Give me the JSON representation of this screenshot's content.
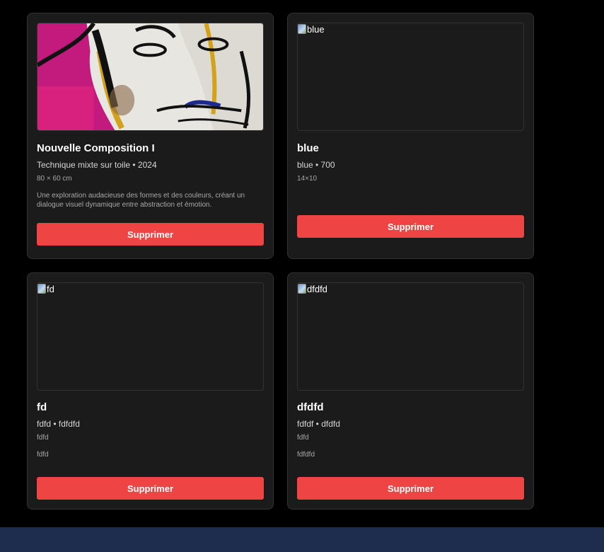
{
  "artworks": [
    {
      "has_image": true,
      "image_alt": "",
      "title": "Nouvelle Composition I",
      "meta": "Technique mixte sur toile • 2024",
      "dimensions": "80 × 60 cm",
      "description": "Une exploration audacieuse des formes et des couleurs, créant un dialogue visuel dynamique entre abstraction et émotion.",
      "delete_label": "Supprimer"
    },
    {
      "has_image": false,
      "image_alt": "blue",
      "title": "blue",
      "meta": "blue • 700",
      "dimensions": "14×10",
      "description": "",
      "delete_label": "Supprimer"
    },
    {
      "has_image": false,
      "image_alt": "fd",
      "title": "fd",
      "meta": "fdfd • fdfdfd",
      "dimensions": "fdfd",
      "description": "fdfd",
      "delete_label": "Supprimer"
    },
    {
      "has_image": false,
      "image_alt": "dfdfd",
      "title": "dfdfd",
      "meta": "fdfdf • dfdfd",
      "dimensions": "fdfd",
      "description": "fdfdfd",
      "delete_label": "Supprimer"
    }
  ],
  "colors": {
    "background": "#000000",
    "card": "#1b1b1b",
    "danger": "#ef4444",
    "footer": "#1e2d4d"
  }
}
